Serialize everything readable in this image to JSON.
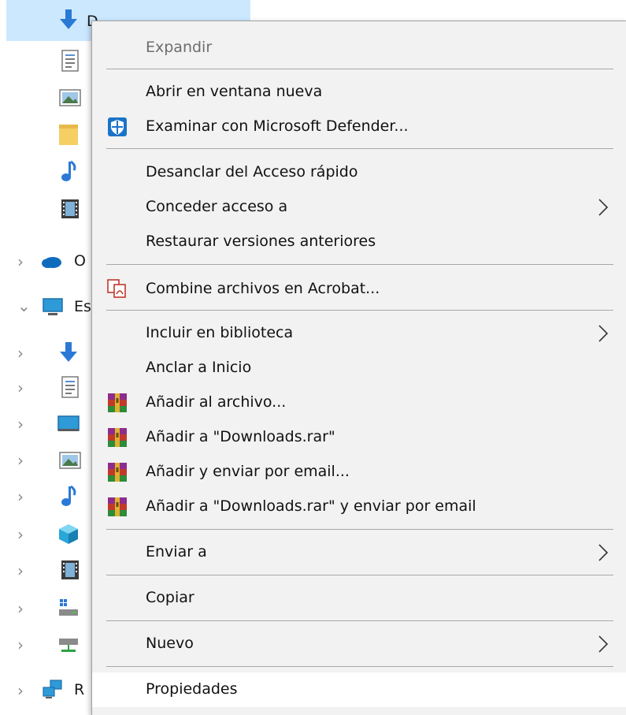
{
  "nav": {
    "selected_partial": "D",
    "onedrive_partial": "O",
    "this_pc_partial": "Es",
    "network_partial": "R"
  },
  "menu": {
    "items": [
      {
        "label": "Expandir",
        "enabled": false
      },
      {
        "label": "Abrir en ventana nueva"
      },
      {
        "label": "Examinar con Microsoft Defender...",
        "icon": "defender-shield-icon"
      },
      {
        "label": "Desanclar del Acceso rápido"
      },
      {
        "label": "Conceder acceso a",
        "submenu": true
      },
      {
        "label": "Restaurar versiones anteriores"
      },
      {
        "label": "Combine archivos en Acrobat...",
        "icon": "acrobat-combine-icon"
      },
      {
        "label": "Incluir en biblioteca",
        "submenu": true
      },
      {
        "label": "Anclar a Inicio"
      },
      {
        "label": "Añadir al archivo...",
        "icon": "winrar-icon"
      },
      {
        "label": "Añadir a \"Downloads.rar\"",
        "icon": "winrar-icon"
      },
      {
        "label": "Añadir y enviar por email...",
        "icon": "winrar-icon"
      },
      {
        "label": "Añadir a \"Downloads.rar\" y enviar por email",
        "icon": "winrar-icon"
      },
      {
        "label": "Enviar a",
        "submenu": true
      },
      {
        "label": "Copiar"
      },
      {
        "label": "Nuevo",
        "submenu": true
      },
      {
        "label": "Propiedades",
        "highlighted": true
      }
    ]
  },
  "colors": {
    "menu_bg": "#f2f2f2",
    "selection": "#cce8ff",
    "accent": "#2b79d6"
  }
}
